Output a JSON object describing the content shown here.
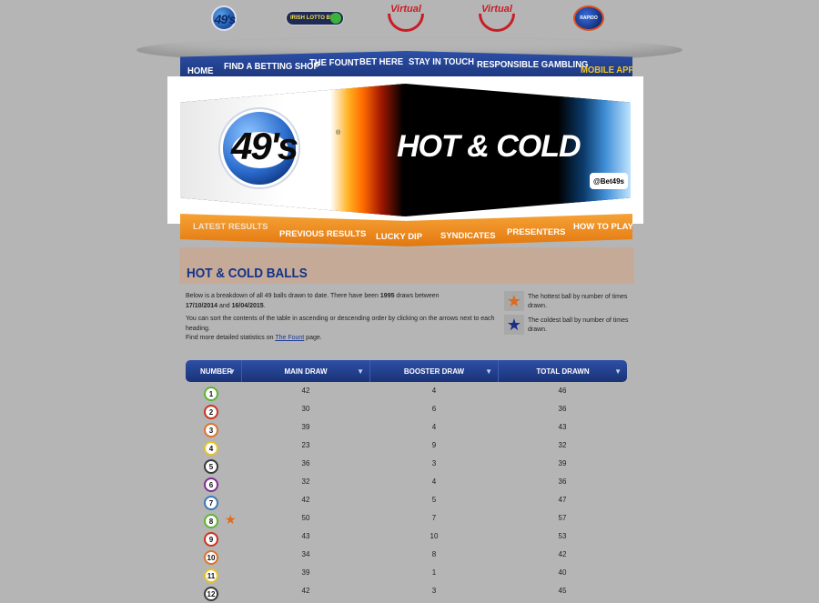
{
  "logos": {
    "logo_49s": "49's",
    "irish_lotto": "IRISH LOTTO BET",
    "virtual_1": "Virtual",
    "virtual_2": "Virtual",
    "rapido": "RAPIDO"
  },
  "main_nav": [
    "HOME",
    "FIND A BETTING SHOP",
    "THE FOUNT",
    "BET HERE",
    "STAY IN TOUCH",
    "RESPONSIBLE GAMBLING",
    "MOBILE APP"
  ],
  "banner": {
    "logo_text": "49's",
    "registered": "®",
    "headline": "HOT & COLD",
    "handle": "@Bet49s"
  },
  "sub_nav": [
    "LATEST RESULTS",
    "PREVIOUS RESULTS",
    "LUCKY DIP",
    "SYNDICATES",
    "PRESENTERS",
    "HOW TO PLAY"
  ],
  "page_title": "HOT & COLD BALLS",
  "intro": {
    "line1_pre": "Below is a breakdown of all 49 balls drawn to date. There have been ",
    "draw_count": "1995",
    "line1_mid": " draws between",
    "date_from": "17/10/2014",
    "and": " and ",
    "date_to": "16/04/2015",
    "period": ".",
    "sort_note": "You can sort the contents of the table in ascending or descending order by clicking on the arrows next to each heading.",
    "more_pre": "Find more detailed statistics on ",
    "more_link": "The Fount",
    "more_post": " page."
  },
  "legend": {
    "hot": "The hottest ball by number of times drawn.",
    "cold": "The coldest ball by number of times drawn."
  },
  "table": {
    "headers": [
      "NUMBER",
      "MAIN DRAW",
      "BOOSTER DRAW",
      "TOTAL DRAWN"
    ],
    "rows": [
      {
        "n": "1",
        "main": "42",
        "booster": "4",
        "total": "46",
        "color": "#5cb531",
        "hot": false
      },
      {
        "n": "2",
        "main": "30",
        "booster": "6",
        "total": "36",
        "color": "#c9341f",
        "hot": false
      },
      {
        "n": "3",
        "main": "39",
        "booster": "4",
        "total": "43",
        "color": "#e0722b",
        "hot": false
      },
      {
        "n": "4",
        "main": "23",
        "booster": "9",
        "total": "32",
        "color": "#e8c229",
        "hot": false
      },
      {
        "n": "5",
        "main": "36",
        "booster": "3",
        "total": "39",
        "color": "#3a3a3a",
        "hot": false
      },
      {
        "n": "6",
        "main": "32",
        "booster": "4",
        "total": "36",
        "color": "#7d2d92",
        "hot": false
      },
      {
        "n": "7",
        "main": "42",
        "booster": "5",
        "total": "47",
        "color": "#3c78b8",
        "hot": false
      },
      {
        "n": "8",
        "main": "50",
        "booster": "7",
        "total": "57",
        "color": "#5cb531",
        "hot": true
      },
      {
        "n": "9",
        "main": "43",
        "booster": "10",
        "total": "53",
        "color": "#c9341f",
        "hot": false
      },
      {
        "n": "10",
        "main": "34",
        "booster": "8",
        "total": "42",
        "color": "#e0722b",
        "hot": false
      },
      {
        "n": "11",
        "main": "39",
        "booster": "1",
        "total": "40",
        "color": "#e8c229",
        "hot": false
      },
      {
        "n": "12",
        "main": "42",
        "booster": "3",
        "total": "45",
        "color": "#3a3a3a",
        "hot": false
      }
    ]
  }
}
